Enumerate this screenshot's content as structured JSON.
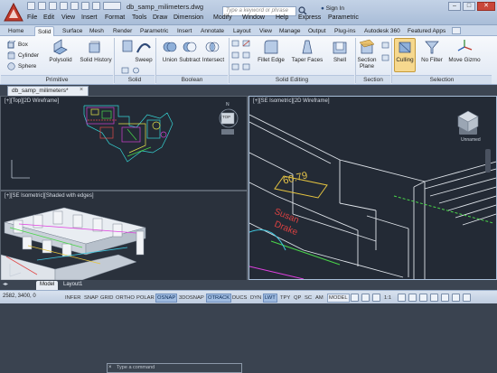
{
  "window": {
    "title": "db_samp_milimeters.dwg",
    "search_placeholder": "Type a keyword or phrase",
    "sign_in": "Sign In",
    "controls": [
      "–",
      "□",
      "✕"
    ]
  },
  "menu": [
    "File",
    "Edit",
    "View",
    "Insert",
    "Format",
    "Tools",
    "Draw",
    "Dimension",
    "Modify",
    "Window",
    "Help",
    "Express",
    "Parametric"
  ],
  "ribbon_tabs": [
    "Home",
    "Solid",
    "Surface",
    "Mesh",
    "Render",
    "Parametric",
    "Insert",
    "Annotate",
    "Layout",
    "View",
    "Manage",
    "Output",
    "Plug-ins",
    "Autodesk 360",
    "Featured Apps"
  ],
  "ribbon_active_tab": "Solid",
  "ribbon": {
    "primitive": {
      "title": "Primitive",
      "box": "Box",
      "cylinder": "Cylinder",
      "sphere": "Sphere",
      "polysolid": "Polysolid"
    },
    "solid": {
      "title": "Solid",
      "history": "Solid History",
      "sweep": "Sweep"
    },
    "boolean": {
      "title": "Boolean",
      "union": "Union",
      "subtract": "Subtract",
      "intersect": "Intersect"
    },
    "solid_editing": {
      "title": "Solid Editing",
      "fillet_edge": "Fillet Edge",
      "taper_faces": "Taper Faces",
      "shell": "Shell"
    },
    "section": {
      "title": "Section",
      "section_plane": "Section Plane"
    },
    "selection": {
      "title": "Selection",
      "culling": "Culling",
      "no_filter": "No Filter",
      "move_gizmo": "Move Gizmo"
    }
  },
  "file_tab": "db_samp_milimeters*",
  "viewports": [
    {
      "label": "[+][Top][2D Wireframe]",
      "compass": "N",
      "viewcube": "TOP"
    },
    {
      "label": "[+][SE Isometric][2D Wireframe]",
      "named_view": "Unnamed"
    },
    {
      "label": "[+][SE Isometric][Shaded with edges]"
    }
  ],
  "drawing_text": {
    "room_number": "60.79",
    "room_name_1": "Susan",
    "room_name_2": "Drake"
  },
  "command_placeholder": "Type a command",
  "layout_tabs": [
    "Model",
    "Layout1"
  ],
  "status": {
    "coords": "2582, 3400, 0",
    "toggles": [
      "INFER",
      "SNAP",
      "GRID",
      "ORTHO",
      "POLAR",
      "OSNAP",
      "3DOSNAP",
      "OTRACK",
      "DUCS",
      "DYN",
      "LWT",
      "TPY",
      "QP",
      "SC",
      "AM"
    ],
    "toggles_on": [
      "OSNAP",
      "OTRACK",
      "LWT"
    ],
    "model": "MODEL",
    "scale": "1:1"
  },
  "colors": {
    "accent": "#2c5ea6",
    "ribbon_bg": "#e3eaf4",
    "viewport_bg": "#232a35",
    "room_text": "#d94141",
    "dim_text": "#e6c44a"
  }
}
